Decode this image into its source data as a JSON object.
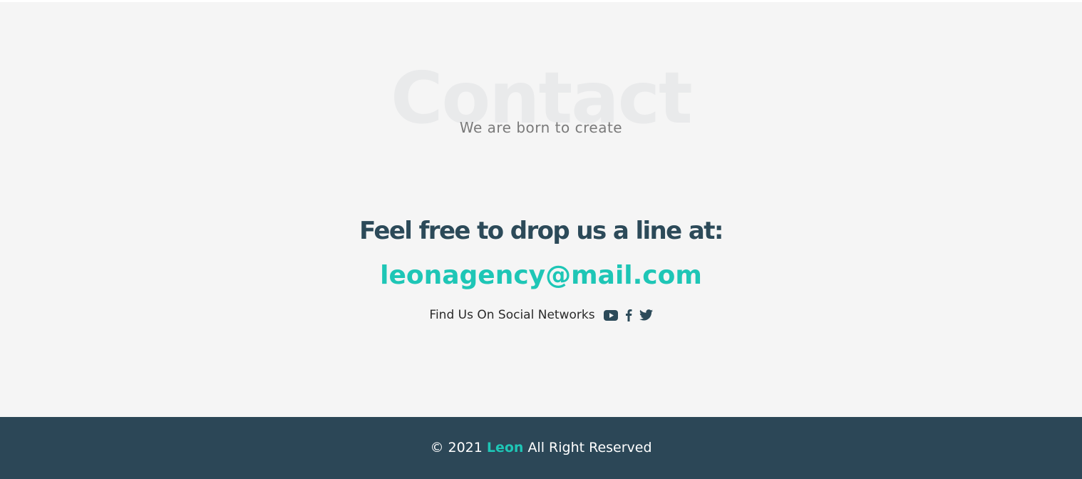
{
  "contact": {
    "background_title": "Contact",
    "subtitle": "We are born to create",
    "drop_line": "Feel free to drop us a line at:",
    "email": "leonagency@mail.com",
    "social_label": "Find Us On Social Networks",
    "social_icons": [
      "youtube-icon",
      "facebook-icon",
      "twitter-icon"
    ]
  },
  "footer": {
    "copyright_prefix": "© 2021",
    "brand": "Leon",
    "copyright_suffix": "All Right Reserved"
  },
  "colors": {
    "section_background": "#f5f5f5",
    "heading": "#2c4a59",
    "accent": "#1ec6b6",
    "footer_background": "#2c4757",
    "watermark": "#e9eaeb"
  }
}
